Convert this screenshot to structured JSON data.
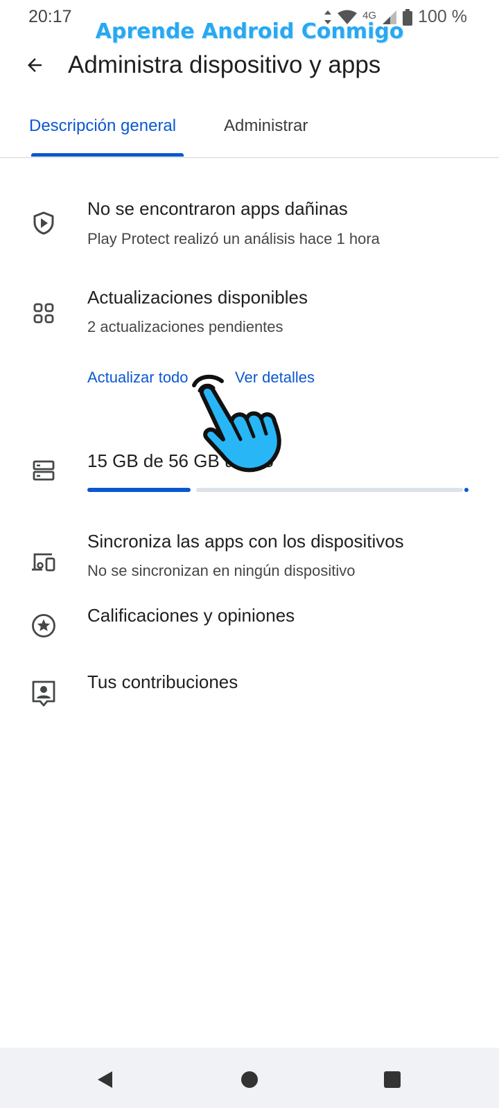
{
  "status_bar": {
    "time": "20:17",
    "network": "4G",
    "battery": "100 %",
    "icons": [
      "data-arrows-icon",
      "wifi-icon",
      "signal-icon",
      "battery-icon"
    ]
  },
  "watermark": "Aprende Android Conmigo",
  "app_bar": {
    "back_icon": "arrow-back-icon",
    "title": "Administra dispositivo y apps"
  },
  "tabs": [
    {
      "label": "Descripción general",
      "selected": true
    },
    {
      "label": "Administrar",
      "selected": false
    }
  ],
  "rows": {
    "protect": {
      "icon": "shield-play-icon",
      "title": "No se encontraron apps dañinas",
      "subtitle": "Play Protect realizó un análisis hace 1 hora"
    },
    "updates": {
      "icon": "apps-grid-icon",
      "title": "Actualizaciones disponibles",
      "subtitle": "2 actualizaciones pendientes",
      "update_all_label": "Actualizar todo",
      "details_label": "Ver detalles"
    },
    "storage": {
      "icon": "storage-icon",
      "title": "15 GB de 56 GB usado",
      "used_fraction": 0.27
    },
    "sync": {
      "icon": "devices-sync-icon",
      "title": "Sincroniza las apps con los dispositivos",
      "subtitle": "No se sincronizan en ningún dispositivo"
    },
    "ratings": {
      "icon": "star-circle-icon",
      "title": "Calificaciones y opiniones"
    },
    "contributions": {
      "icon": "contributions-icon",
      "title": "Tus contribuciones"
    }
  },
  "overlay": {
    "icon": "pointing-hand-icon"
  },
  "nav_bar": {
    "icons": [
      "nav-back-icon",
      "nav-home-icon",
      "nav-recents-icon"
    ]
  },
  "colors": {
    "accent": "#0b57d0",
    "watermark": "#29a8f0",
    "hand": "#29b6f6",
    "storage_track": "#dde3ea"
  }
}
